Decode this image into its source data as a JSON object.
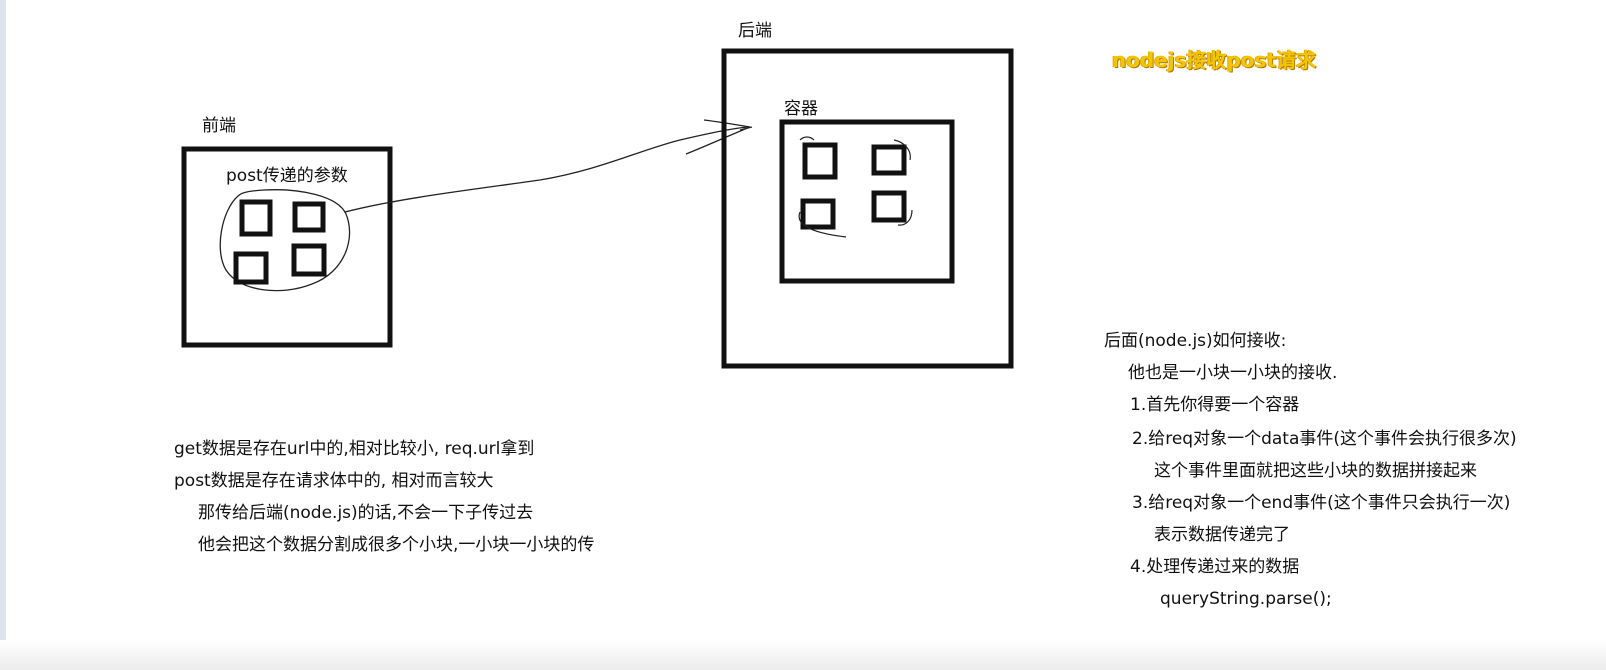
{
  "frontend": {
    "title": "前端",
    "params_label": "post传递的参数"
  },
  "backend": {
    "title": "后端",
    "container_label": "容器"
  },
  "topic_note": "nodejs接收post请求",
  "left_notes": {
    "lines": [
      "get数据是存在url中的,相对比较小, req.url拿到",
      "post数据是存在请求体中的, 相对而言较大",
      "那传给后端(node.js)的话,不会一下子传过去",
      "他会把这个数据分割成很多个小块,一小块一小块的传"
    ]
  },
  "right_notes": {
    "lines": [
      "后面(node.js)如何接收:",
      "他也是一小块一小块的接收.",
      "1.首先你得要一个容器",
      "2.给req对象一个data事件(这个事件会执行很多次)",
      "这个事件里面就把这些小块的数据拼接起来",
      "3.给req对象一个end事件(这个事件只会执行一次)",
      "表示数据传递完了",
      "4.处理传递过来的数据",
      "queryString.parse();"
    ]
  },
  "colors": {
    "ink": "#111111",
    "note": "#f5c400"
  }
}
